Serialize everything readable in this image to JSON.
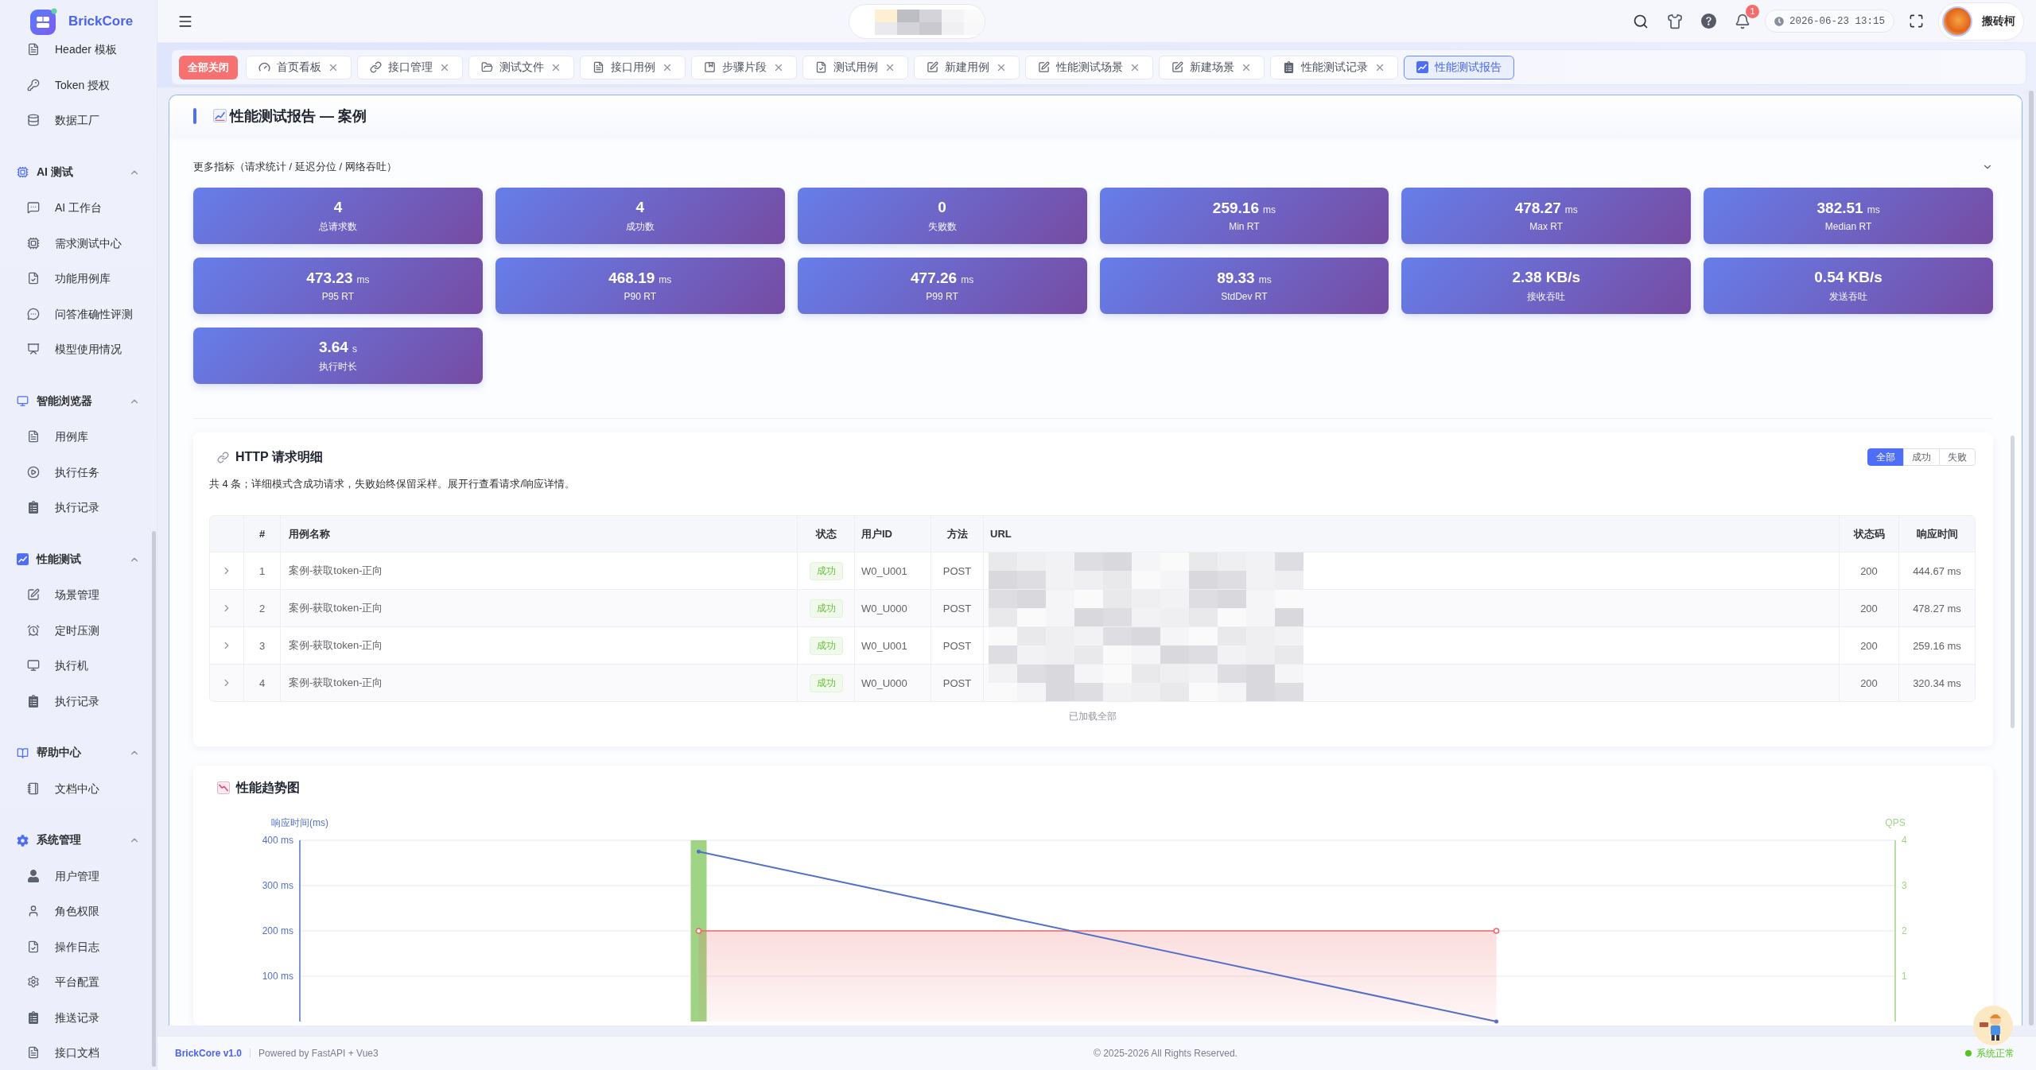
{
  "sidebar": {
    "brand": "BrickCore",
    "items": [
      {
        "label": "Header 模板",
        "selected": false
      },
      {
        "label": "Token 授权",
        "selected": false
      },
      {
        "label": "数据工厂",
        "selected": false
      }
    ],
    "groups": [
      {
        "title": "AI 测试",
        "expanded": true,
        "items": [
          {
            "label": "AI 工作台",
            "selected": false
          },
          {
            "label": "需求测试中心",
            "selected": false
          },
          {
            "label": "功能用例库",
            "selected": false
          },
          {
            "label": "问答准确性评测",
            "selected": false
          },
          {
            "label": "模型使用情况",
            "selected": false
          }
        ]
      },
      {
        "title": "智能浏览器",
        "expanded": true,
        "items": [
          {
            "label": "用例库",
            "selected": false
          },
          {
            "label": "执行任务",
            "selected": false
          },
          {
            "label": "执行记录",
            "selected": false
          }
        ]
      },
      {
        "title": "性能测试",
        "expanded": true,
        "items": [
          {
            "label": "场景管理",
            "selected": false
          },
          {
            "label": "定时压测",
            "selected": false
          },
          {
            "label": "执行机",
            "selected": false
          },
          {
            "label": "执行记录",
            "selected": false
          }
        ]
      },
      {
        "title": "帮助中心",
        "expanded": true,
        "items": [
          {
            "label": "文档中心",
            "selected": false
          }
        ]
      },
      {
        "title": "系统管理",
        "expanded": true,
        "items": [
          {
            "label": "用户管理",
            "selected": false
          },
          {
            "label": "角色权限",
            "selected": false
          },
          {
            "label": "操作日志",
            "selected": false
          },
          {
            "label": "平台配置",
            "selected": false
          },
          {
            "label": "推送记录",
            "selected": false
          },
          {
            "label": "接口文档",
            "selected": false
          }
        ]
      }
    ]
  },
  "top_bar": {
    "notification_count": "1",
    "datetime": "2026-06-23 13:15",
    "user_name": "搬砖柯"
  },
  "close_all_button": "全部关闭",
  "tabs": [
    {
      "label": "首页看板",
      "selected": false
    },
    {
      "label": "接口管理",
      "selected": false
    },
    {
      "label": "测试文件",
      "selected": false
    },
    {
      "label": "接口用例",
      "selected": false
    },
    {
      "label": "步骤片段",
      "selected": false
    },
    {
      "label": "测试用例",
      "selected": false
    },
    {
      "label": "新建用例",
      "selected": false
    },
    {
      "label": "性能测试场景",
      "selected": false
    },
    {
      "label": "新建场景",
      "selected": false
    },
    {
      "label": "性能测试记录",
      "selected": false
    },
    {
      "label": "性能测试报告",
      "selected": true
    }
  ],
  "page": {
    "title": "性能测试报告 — 案例",
    "metrics": {
      "title": "更多指标（请求统计 / 延迟分位 / 网络吞吐）",
      "expanded": true,
      "cards": [
        {
          "value": "4",
          "label": "总请求数"
        },
        {
          "value": "4",
          "label": "成功数"
        },
        {
          "value": "0",
          "label": "失败数"
        },
        {
          "value": "259.16",
          "unit": "ms",
          "label": "Min RT"
        },
        {
          "value": "478.27",
          "unit": "ms",
          "label": "Max RT"
        },
        {
          "value": "382.51",
          "unit": "ms",
          "label": "Median RT"
        },
        {
          "value": "473.23",
          "unit": "ms",
          "label": "P95 RT"
        },
        {
          "value": "468.19",
          "unit": "ms",
          "label": "P90 RT"
        },
        {
          "value": "477.26",
          "unit": "ms",
          "label": "P99 RT"
        },
        {
          "value": "89.33",
          "unit": "ms",
          "label": "StdDev RT"
        },
        {
          "value": "2.38 KB/s",
          "label": "接收吞吐"
        },
        {
          "value": "0.54 KB/s",
          "label": "发送吞吐"
        },
        {
          "value": "3.64",
          "unit": "s",
          "label": "执行时长"
        }
      ]
    },
    "http": {
      "title": "HTTP 请求明细",
      "filters": [
        {
          "label": "全部",
          "selected": true
        },
        {
          "label": "成功",
          "selected": false
        },
        {
          "label": "失败",
          "selected": false
        }
      ],
      "description": "共 4 条；详细模式含成功请求，失败始终保留采样。展开行查看请求/响应详情。",
      "table": {
        "columns": [
          "#",
          "用例名称",
          "状态",
          "用户ID",
          "方法",
          "URL",
          "状态码",
          "响应时间"
        ],
        "rows": [
          {
            "expanded": false,
            "index": "1",
            "name": "案例-获取token-正向",
            "status": "成功",
            "success": true,
            "user_id": "W0_U001",
            "method": "POST",
            "status_code": "200",
            "response_time": "444.67 ms"
          },
          {
            "expanded": false,
            "index": "2",
            "name": "案例-获取token-正向",
            "status": "成功",
            "success": true,
            "user_id": "W0_U000",
            "method": "POST",
            "status_code": "200",
            "response_time": "478.27 ms"
          },
          {
            "expanded": false,
            "index": "3",
            "name": "案例-获取token-正向",
            "status": "成功",
            "success": true,
            "user_id": "W0_U001",
            "method": "POST",
            "status_code": "200",
            "response_time": "259.16 ms"
          },
          {
            "expanded": false,
            "index": "4",
            "name": "案例-获取token-正向",
            "status": "成功",
            "success": true,
            "user_id": "W0_U000",
            "method": "POST",
            "status_code": "200",
            "response_time": "320.34 ms"
          }
        ]
      },
      "load_status": "已加载全部"
    },
    "chart": {
      "title": "性能趋势图",
      "chart_data": {
        "type": "line",
        "ylabel": "响应时间(ms)",
        "y2label": "QPS",
        "ylim": [
          0,
          400
        ],
        "y2lim": [
          0,
          4
        ],
        "grid": true,
        "yticks": [
          {
            "value": 100,
            "label": "100 ms"
          },
          {
            "value": 200,
            "label": "200 ms"
          },
          {
            "value": 300,
            "label": "300 ms"
          },
          {
            "value": 400,
            "label": "400 ms"
          }
        ],
        "y2ticks": [
          1,
          2,
          3,
          4
        ],
        "series": [
          {
            "color": "#5470c6",
            "values": [
              375,
              0
            ]
          },
          {
            "type": "bar",
            "axis": "y2",
            "color": "#9fd485",
            "values": [
              4,
              0
            ]
          },
          {
            "type": "area",
            "axis": "y2",
            "color": "#ee6666",
            "values": [
              2,
              2
            ]
          }
        ]
      }
    }
  },
  "footer": {
    "brand": "BrickCore v1.0",
    "powered": "Powered by FastAPI + Vue3",
    "copyright": "© 2025-2026 All Rights Reserved.",
    "status": "系统正常",
    "status_ok": true
  }
}
